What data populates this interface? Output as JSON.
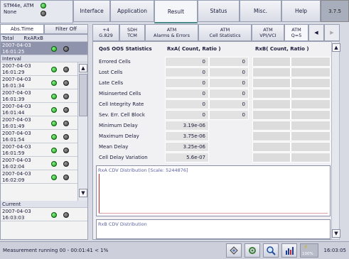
{
  "header": {
    "instrument_line1": "STM4e, ATM",
    "instrument_line2": "None",
    "tabs": [
      {
        "label": "Interface"
      },
      {
        "label": "Application"
      },
      {
        "label": "Result"
      },
      {
        "label": "Status"
      },
      {
        "label": "Misc."
      },
      {
        "label": "Help"
      }
    ],
    "active_tab": "Result",
    "version": "3.7.5"
  },
  "left": {
    "tabs": [
      {
        "label": "Abs.Time"
      },
      {
        "label": "Filter Off"
      }
    ],
    "total": {
      "heading": "Total",
      "columns": "RxARxB",
      "row": {
        "date": "2007-04-03",
        "time": "16:01:25"
      }
    },
    "interval": {
      "heading": "Interval",
      "rows": [
        {
          "date": "2007-04-03",
          "time": "16:01:29"
        },
        {
          "date": "2007-04-03",
          "time": "16:01:34"
        },
        {
          "date": "2007-04-03",
          "time": "16:01:39"
        },
        {
          "date": "2007-04-03",
          "time": "16:01:44"
        },
        {
          "date": "2007-04-03",
          "time": "16:01:49"
        },
        {
          "date": "2007-04-03",
          "time": "16:01:54"
        },
        {
          "date": "2007-04-03",
          "time": "16:01:59"
        },
        {
          "date": "2007-04-03",
          "time": "16:02:04"
        },
        {
          "date": "2007-04-03",
          "time": "16:02:09"
        }
      ]
    },
    "current": {
      "heading": "Current",
      "row": {
        "date": "2007-04-03",
        "time": "16:03:03"
      }
    }
  },
  "subtabs": [
    {
      "line1": "+4",
      "line2": "G.829"
    },
    {
      "line1": "SDH",
      "line2": "TCM"
    },
    {
      "line1": "ATM",
      "line2": "Alarms & Errors"
    },
    {
      "line1": "ATM",
      "line2": "Cell Statistics"
    },
    {
      "line1": "ATM",
      "line2": "VPI/VCI"
    },
    {
      "line1": "ATM",
      "line2": "Q=5"
    }
  ],
  "qos": {
    "heading": "QoS OOS Statistics",
    "rxa_heading": "RxA( Count, Ratio )",
    "rxb_heading": "RxB( Count, Ratio )",
    "rows": [
      {
        "label": "Errored Cells",
        "rxa_count": "0",
        "rxa_ratio": "0"
      },
      {
        "label": "Lost Cells",
        "rxa_count": "0",
        "rxa_ratio": "0"
      },
      {
        "label": "Late Cells",
        "rxa_count": "0",
        "rxa_ratio": "0"
      },
      {
        "label": "Misinserted Cells",
        "rxa_count": "0",
        "rxa_ratio": "0"
      },
      {
        "label": "Cell Integrity Rate",
        "rxa_count": "0",
        "rxa_ratio": "0"
      },
      {
        "label": "Sev. Err. Cell Block",
        "rxa_count": "0",
        "rxa_ratio": "0"
      },
      {
        "label": "Minimum Delay",
        "rxa_count": "3.19e-06",
        "rxa_ratio": ""
      },
      {
        "label": "Maximum Delay",
        "rxa_count": "3.75e-06",
        "rxa_ratio": ""
      },
      {
        "label": "Mean Delay",
        "rxa_count": "3.25e-06",
        "rxa_ratio": ""
      },
      {
        "label": "Cell Delay Variation",
        "rxa_count": "5.6e-07",
        "rxa_ratio": ""
      }
    ]
  },
  "dist": {
    "rxa_title": "RxA CDV Distribution [Scale: 5244876]",
    "rxb_title": "RxB CDV Distribution"
  },
  "status": {
    "text": "Measurement running 00 - 00:01:41 < 1%",
    "battery": "100%",
    "clock": "16:03:05"
  }
}
